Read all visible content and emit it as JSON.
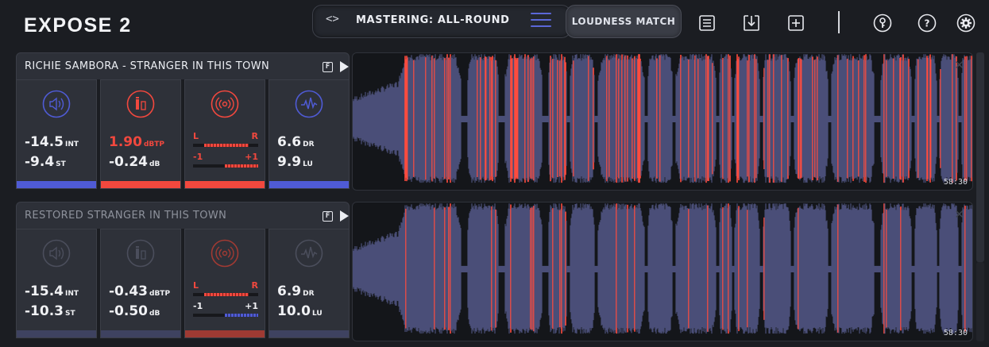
{
  "app": {
    "title": "EXPOSE 2"
  },
  "preset": {
    "arrows": "<>",
    "name": "MASTERING: ALL-ROUND"
  },
  "toolbar": {
    "loudness_match": "LOUDNESS MATCH"
  },
  "colors": {
    "blue": "#4f5bd5",
    "red": "#f2483e",
    "wave_blue": "#4a4f78",
    "wave_red": "#ff4b3e"
  },
  "tracks": [
    {
      "title": "RICHIE SAMBORA - STRANGER IN THIS TOWN",
      "f_label": "F",
      "time": "58:30",
      "close": "✕",
      "loudness": {
        "int": "-14.5",
        "int_unit": "INT",
        "st": "-9.4",
        "st_unit": "ST"
      },
      "peak": {
        "dbtp": "1.90",
        "dbtp_unit": "dBTP",
        "db": "-0.24",
        "db_unit": "dB"
      },
      "stereo": {
        "l": "L",
        "r": "R",
        "neg": "-1",
        "pos": "+1"
      },
      "dynamics": {
        "dr": "6.6",
        "dr_unit": "DR",
        "lu": "9.9",
        "lu_unit": "LU"
      }
    },
    {
      "title": "RESTORED STRANGER IN THIS TOWN",
      "f_label": "F",
      "time": "58:30",
      "close": "✕",
      "loudness": {
        "int": "-15.4",
        "int_unit": "INT",
        "st": "-10.3",
        "st_unit": "ST"
      },
      "peak": {
        "dbtp": "-0.43",
        "dbtp_unit": "dBTP",
        "db": "-0.50",
        "db_unit": "dB"
      },
      "stereo": {
        "l": "L",
        "r": "R",
        "neg": "-1",
        "pos": "+1"
      },
      "dynamics": {
        "dr": "6.9",
        "dr_unit": "DR",
        "lu": "10.0",
        "lu_unit": "LU"
      }
    }
  ]
}
